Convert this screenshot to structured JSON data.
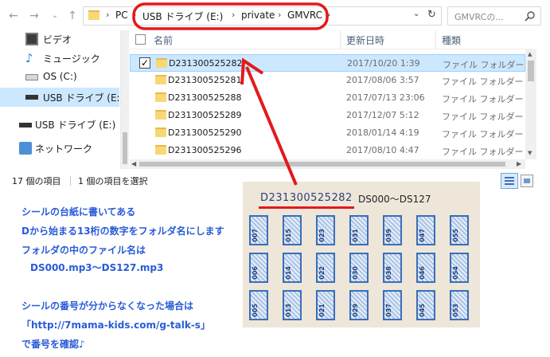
{
  "address_bar": {
    "crumbs": [
      "PC",
      "USB ドライブ (E:)",
      "private",
      "GMVRC"
    ],
    "search_placeholder": "GMVRCの..."
  },
  "nav_pane": {
    "items": [
      {
        "label": "ビデオ",
        "icon": "video-icon"
      },
      {
        "label": "ミュージック",
        "icon": "music-icon"
      },
      {
        "label": "OS (C:)",
        "icon": "drive-icon"
      },
      {
        "label": "USB ドライブ (E:)",
        "icon": "usb-drive-icon",
        "selected": true
      },
      {
        "label": "USB ドライブ (E:)",
        "icon": "usb-drive-icon"
      },
      {
        "label": "ネットワーク",
        "icon": "network-icon"
      }
    ]
  },
  "file_list": {
    "headers": {
      "name": "名前",
      "date": "更新日時",
      "type": "種類"
    },
    "rows": [
      {
        "name": "D231300525282",
        "date": "2017/10/20 1:39",
        "type": "ファイル フォルダー",
        "selected": true
      },
      {
        "name": "D231300525281",
        "date": "2017/08/06 3:57",
        "type": "ファイル フォルダー"
      },
      {
        "name": "D231300525288",
        "date": "2017/07/13 23:06",
        "type": "ファイル フォルダー"
      },
      {
        "name": "D231300525289",
        "date": "2017/12/07 5:12",
        "type": "ファイル フォルダー"
      },
      {
        "name": "D231300525290",
        "date": "2018/01/14 4:19",
        "type": "ファイル フォルダー"
      },
      {
        "name": "D231300525296",
        "date": "2017/08/10 4:47",
        "type": "ファイル フォルダー"
      }
    ]
  },
  "status_bar": {
    "count": "17 個の項目",
    "selected": "1 個の項目を選択"
  },
  "notes": [
    "シールの台紙に書いてある",
    "Dから始まる13桁の数字をフォルダ名にします",
    "フォルダの中のファイル名は",
    "DS000.mp3～DS127.mp3",
    "シールの番号が分からなくなった場合は",
    "「http://7mama-kids.com/g-talk-s」",
    "で番号を確認♪"
  ],
  "photo": {
    "code": "D231300525282",
    "range": "DS000～DS127",
    "stamp_rows": [
      [
        "007",
        "015",
        "023",
        "031",
        "039",
        "047",
        "055"
      ],
      [
        "006",
        "014",
        "022",
        "030",
        "038",
        "046",
        "054"
      ],
      [
        "005",
        "013",
        "021",
        "029",
        "037",
        "045",
        "053"
      ]
    ]
  },
  "colors": {
    "highlight_red": "#e3191c",
    "note_blue": "#2a5bd7",
    "selection": "#cce8ff"
  }
}
